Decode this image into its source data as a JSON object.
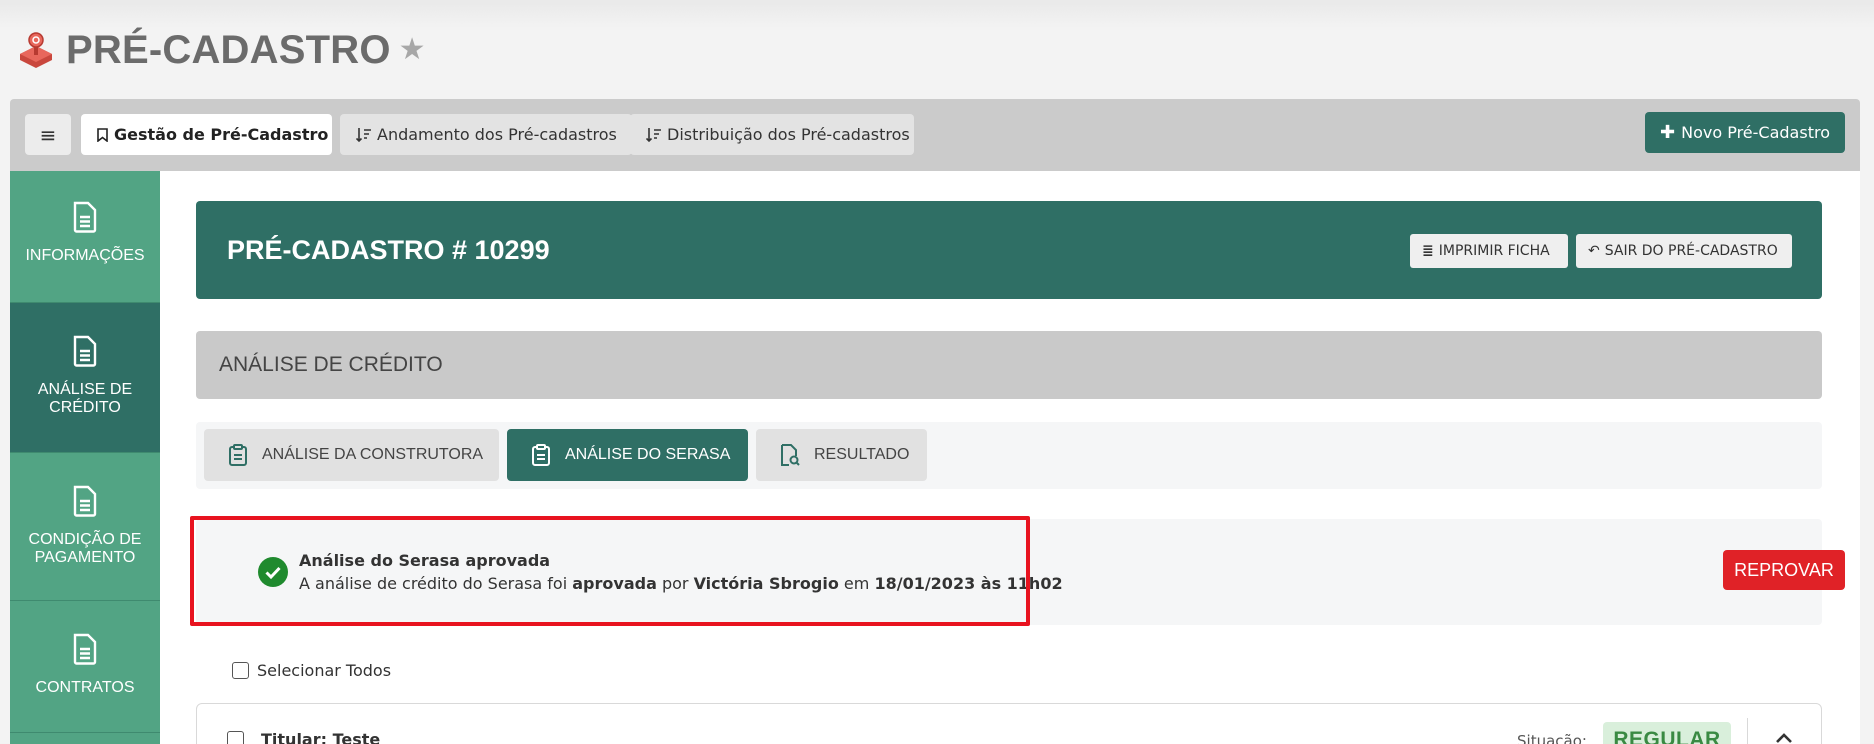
{
  "page": {
    "title": "PRÉ-CADASTRO",
    "app_icon": "joystick-icon",
    "star_icon": "star-icon"
  },
  "topbar": {
    "menu_icon": "hamburger-icon",
    "tabs": [
      {
        "label": "Gestão de Pré-Cadastro",
        "icon": "bookmark-icon",
        "active": true
      },
      {
        "label": "Andamento dos Pré-cadastros",
        "icon": "sort-icon",
        "active": false
      },
      {
        "label": "Distribuição dos Pré-cadastros",
        "icon": "sort-icon",
        "active": false
      }
    ],
    "new_button": {
      "label": "Novo Pré-Cadastro",
      "icon": "plus-icon"
    }
  },
  "sidebar": {
    "items": [
      {
        "label": "INFORMAÇÕES",
        "icon": "document-icon",
        "active": false
      },
      {
        "label_line1": "ANÁLISE DE",
        "label_line2": "CRÉDITO",
        "icon": "document-icon",
        "active": true
      },
      {
        "label_line1": "CONDIÇÃO DE",
        "label_line2": "PAGAMENTO",
        "icon": "document-icon",
        "active": false
      },
      {
        "label": "CONTRATOS",
        "icon": "document-icon",
        "active": false
      }
    ]
  },
  "header_card": {
    "title": "PRÉ-CADASTRO # 10299",
    "print_button": "IMPRIMIR FICHA",
    "exit_button": "SAIR DO PRÉ-CADASTRO"
  },
  "section": {
    "title": "ANÁLISE DE CRÉDITO"
  },
  "subtabs": [
    {
      "label": "ANÁLISE DA CONSTRUTORA",
      "icon": "clipboard-icon",
      "active": false
    },
    {
      "label": "ANÁLISE DO SERASA",
      "icon": "clipboard-icon",
      "active": true
    },
    {
      "label": "RESULTADO",
      "icon": "document-search-icon",
      "active": false
    }
  ],
  "status": {
    "title": "Análise do Serasa aprovada",
    "msg_prefix": "A análise de crédito do Serasa foi",
    "msg_status": "aprovada",
    "msg_by": "por",
    "msg_user": "Victória Sbrogio",
    "msg_on": "em",
    "msg_datetime": "18/01/2023 às 11h02",
    "reject_button": "REPROVAR"
  },
  "select_all": {
    "label": "Selecionar Todos"
  },
  "row": {
    "title": "Titular: Teste",
    "situation_label": "Situação:",
    "situation_value": "REGULAR"
  },
  "colors": {
    "primary": "#2f6f65",
    "sidebar": "#52a484",
    "danger": "#e02227",
    "highlight": "#e8131f",
    "success": "#28a745"
  }
}
